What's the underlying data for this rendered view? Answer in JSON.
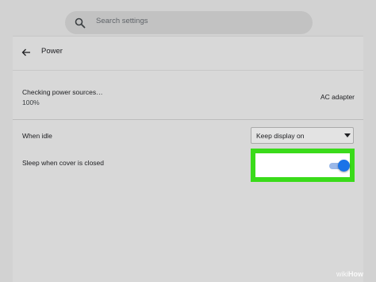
{
  "search": {
    "placeholder": "Search settings"
  },
  "page": {
    "title": "Power"
  },
  "power_source": {
    "label": "Checking power sources…",
    "percent": "100%",
    "value": "AC adapter"
  },
  "idle": {
    "label": "When idle",
    "selected": "Keep display on"
  },
  "sleep_cover": {
    "label": "Sleep when cover is closed",
    "toggle_on": true
  },
  "colors": {
    "accent": "#1a73e8",
    "highlight": "#3adb1a"
  },
  "watermark": {
    "wiki": "wiki",
    "how": "How"
  },
  "icons": {
    "search": "search-icon",
    "back": "arrow-left-icon",
    "dropdown": "chevron-down-icon"
  }
}
